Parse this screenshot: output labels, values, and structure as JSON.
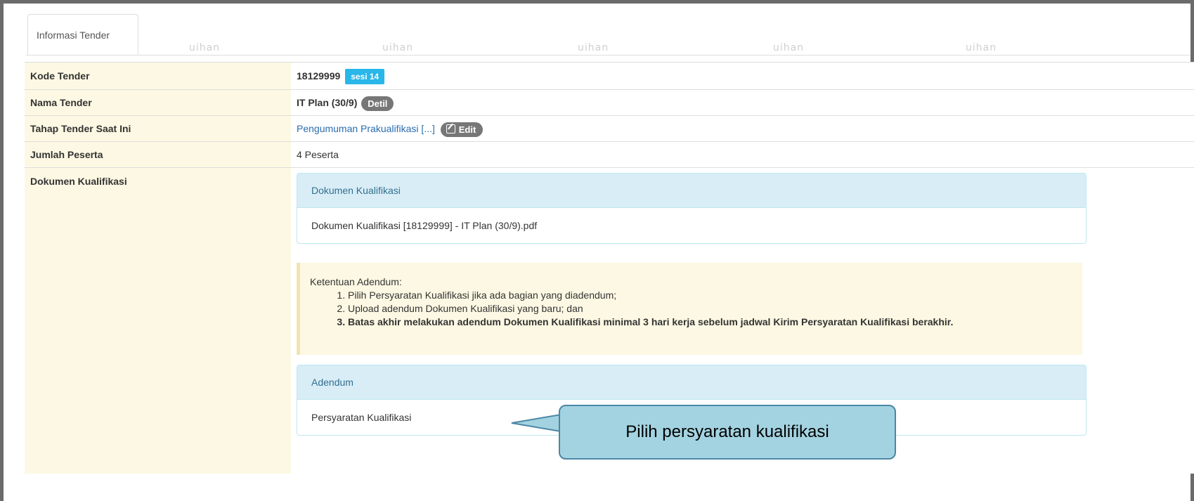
{
  "tabs": [
    {
      "label": "Informasi Tender"
    }
  ],
  "watermark": "uihan",
  "rows": {
    "kode": {
      "label": "Kode Tender",
      "value": "18129999",
      "badge": "sesi 14"
    },
    "nama": {
      "label": "Nama Tender",
      "value": "IT Plan (30/9)",
      "badge": "Detil"
    },
    "tahap": {
      "label": "Tahap Tender Saat Ini",
      "value": "Pengumuman Prakualifikasi [...]",
      "badge": "Edit",
      "badge_icon": "edit-icon"
    },
    "jumlah": {
      "label": "Jumlah Peserta",
      "value": "4 Peserta"
    },
    "dokumen": {
      "label": "Dokumen Kualifikasi"
    }
  },
  "dokumen_panel": {
    "heading": "Dokumen Kualifikasi",
    "file": "Dokumen Kualifikasi [18129999] - IT Plan (30/9).pdf"
  },
  "ketentuan": {
    "title": "Ketentuan Adendum:",
    "items": [
      "Pilih Persyaratan Kualifikasi jika ada bagian yang diadendum;",
      "Upload adendum Dokumen Kualifikasi yang baru; dan",
      "Batas akhir melakukan adendum Dokumen Kualifikasi minimal 3 hari kerja sebelum jadwal Kirim Persyaratan Kualifikasi berakhir."
    ]
  },
  "adendum_panel": {
    "heading": "Adendum",
    "link": "Persyaratan Kualifikasi"
  },
  "callout": {
    "text": "Pilih persyaratan kualifikasi"
  },
  "colors": {
    "label_bg": "#fcf8e3",
    "panel_header": "#d9edf7",
    "sesi_badge": "#29b6e8",
    "callout_bg": "#a3d3e1"
  }
}
